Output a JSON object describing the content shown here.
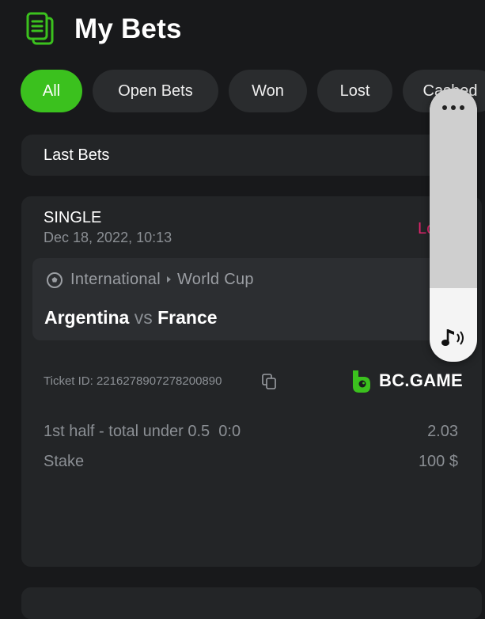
{
  "header": {
    "title": "My Bets",
    "icon": "bets-icon"
  },
  "filters": [
    {
      "label": "All",
      "active": true
    },
    {
      "label": "Open Bets",
      "active": false
    },
    {
      "label": "Won",
      "active": false
    },
    {
      "label": "Lost",
      "active": false
    },
    {
      "label": "Cashed",
      "active": false
    }
  ],
  "last_bets": {
    "label": "Last Bets"
  },
  "bet": {
    "type": "SINGLE",
    "date": "Dec 18, 2022, 10:13",
    "status": "Lost",
    "league": {
      "category": "International",
      "name": "World Cup",
      "icon": "soccer-ball-icon"
    },
    "home_team": "Argentina",
    "vs": "vs",
    "away_team": "France",
    "ticket_id": "Ticket ID: 2216278907278200890",
    "brand": "BC.GAME",
    "selection": "1st half - total under 0.5",
    "selection_score": "0:0",
    "odds": "2.03",
    "stake_label": "Stake",
    "stake_value": "100 $"
  },
  "overlay": {
    "menu_icon": "more-dots-icon",
    "sound_icon": "music-note-icon"
  },
  "colors": {
    "accent": "#3bc11e",
    "background": "#18191b",
    "card": "#232527",
    "lost": "#e0246c"
  }
}
